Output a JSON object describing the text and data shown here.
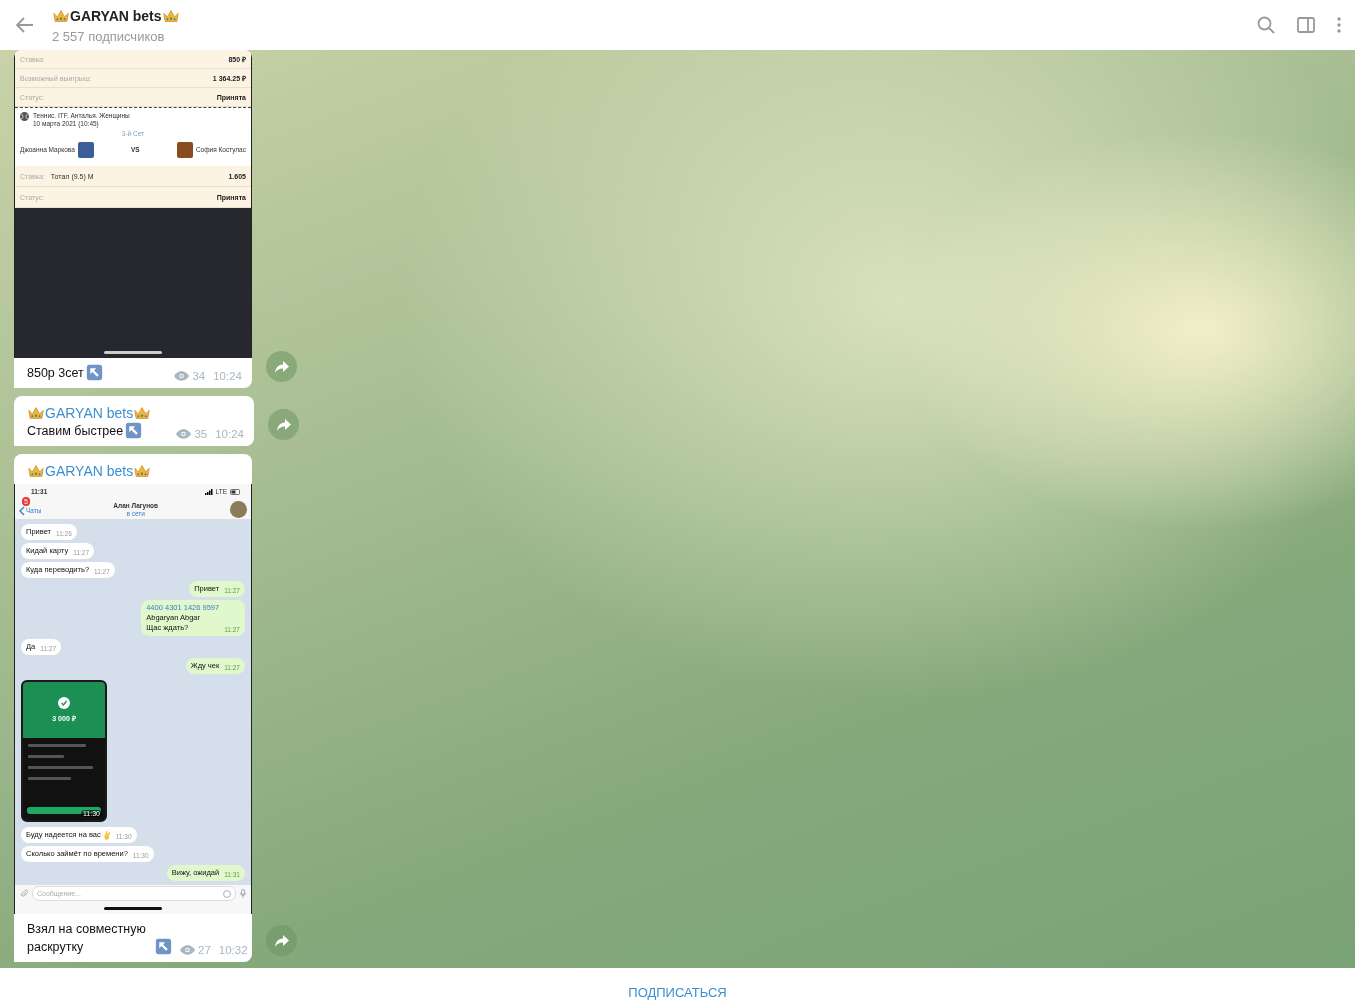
{
  "header": {
    "title": "GARYAN bets",
    "subtitle": "2 557 подписчиков"
  },
  "messages": [
    {
      "kind": "photo",
      "screenshot": {
        "kind": "bet_slip",
        "rows": [
          {
            "label": "Ставка:",
            "value": "850 ₽"
          },
          {
            "label": "Возможный выигрыш:",
            "value": "1 364.25 ₽"
          },
          {
            "label": "Статус:",
            "value": "Принята"
          }
        ],
        "event": {
          "sport": "Теннис. ITF. Анталья. Женщины",
          "date": "10 марта 2021 (10:45)",
          "period": "3-й Сет",
          "player1": "Джоанна Маркова",
          "vs": "VS",
          "player2": "София Костулас"
        },
        "rows2": [
          {
            "label": "Ставка:",
            "bet": "Тотал (9.5) М",
            "value": "1.605"
          },
          {
            "label": "Статус:",
            "value": "Принята"
          }
        ]
      },
      "caption": "850р 3сет",
      "views": "34",
      "time": "10:24"
    },
    {
      "kind": "text",
      "author": "GARYAN bets",
      "text": "Ставим быстрее",
      "views": "35",
      "time": "10:24"
    },
    {
      "kind": "photo",
      "author": "GARYAN bets",
      "screenshot": {
        "kind": "chat",
        "clock": "11:31",
        "network": "LTE",
        "badge": "5",
        "back": "Чаты",
        "contact": "Алан Лагунов",
        "status": "в сети",
        "items": [
          {
            "kind": "text",
            "out": false,
            "text": "Привет",
            "time": "11:26"
          },
          {
            "kind": "text",
            "out": false,
            "text": "Кидай карту",
            "time": "11:27"
          },
          {
            "kind": "text",
            "out": false,
            "text": "Куда переводить?",
            "time": "11:27"
          },
          {
            "kind": "text",
            "out": true,
            "text": "Привет",
            "time": "11:27"
          },
          {
            "kind": "text",
            "out": true,
            "link": "4400 4301 1426 9597",
            "text": "Abgaryan Abgar\nЩас ждать?",
            "time": "11:27"
          },
          {
            "kind": "text",
            "out": false,
            "text": "Да",
            "time": "11:27"
          },
          {
            "kind": "text",
            "out": true,
            "text": "Жду чек",
            "time": "11:27"
          },
          {
            "kind": "receipt",
            "out": false,
            "amount": "3 000 ₽",
            "time": "11:30"
          },
          {
            "kind": "text",
            "out": false,
            "text": "Буду надеется на вас",
            "emoji": true,
            "time": "11:30"
          },
          {
            "kind": "text",
            "out": false,
            "text": "Сколько займёт по времени?",
            "time": "11:30"
          },
          {
            "kind": "text",
            "out": true,
            "text": "Вижу, ожидай",
            "time": "11:31"
          }
        ],
        "placeholder": "Сообщение..."
      },
      "caption": "Взял на совместную раскрутку",
      "views": "27",
      "time": "10:32"
    }
  ],
  "footer": {
    "button": "ПОДПИСАТЬСЯ"
  }
}
